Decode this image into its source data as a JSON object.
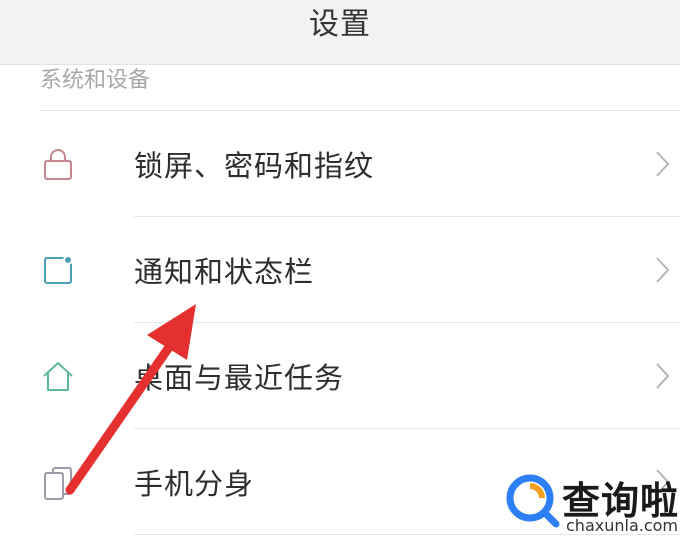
{
  "header": {
    "title": "设置"
  },
  "section": {
    "label": "系统和设备"
  },
  "rows": [
    {
      "label": "锁屏、密码和指纹",
      "icon": "lock-icon",
      "icon_color": "#c6858f"
    },
    {
      "label": "通知和状态栏",
      "icon": "notification-icon",
      "icon_color": "#4a9fb3"
    },
    {
      "label": "桌面与最近任务",
      "icon": "home-icon",
      "icon_color": "#5fb79a"
    },
    {
      "label": "手机分身",
      "icon": "clone-icon",
      "icon_color": "#9a9aa8"
    }
  ],
  "annotation": {
    "arrow_color": "#e53030"
  },
  "watermark": {
    "brand": "查询啦",
    "url": "chaxunla.com",
    "logo_colors": [
      "#2d7ff5",
      "#f0a020"
    ]
  }
}
